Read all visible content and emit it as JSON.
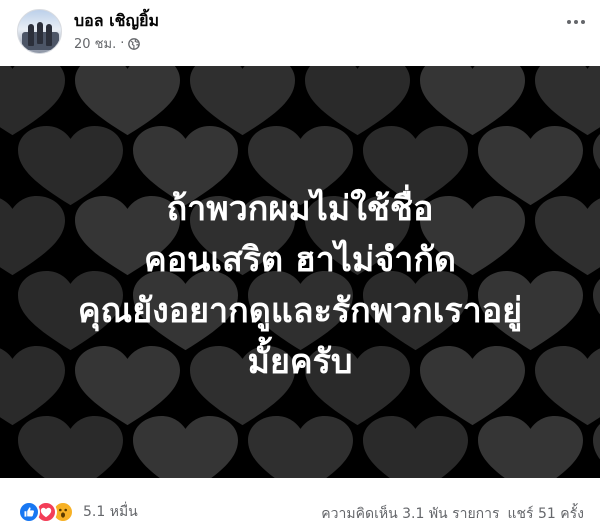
{
  "post": {
    "author": "บอล เชิญยิ้ม",
    "time": "20 ชม.",
    "separator": "·",
    "privacy_icon": "globe-icon",
    "more_icon": "more-options-icon"
  },
  "image": {
    "background": "black-heart-pattern",
    "caption_lines": [
      "ถ้าพวกผมไม่ใช้ชื่อ",
      "คอนเสริต ฮาไม่จำกัด",
      "คุณยังอยากดูและรักพวกเราอยู่",
      "มั้ยครับ"
    ]
  },
  "footer": {
    "reaction_icons": [
      "like-icon",
      "love-icon",
      "wow-icon"
    ],
    "reaction_count": "5.1 หมื่น",
    "comments": "ความคิดเห็น 3.1 พัน รายการ",
    "shares": "แชร์ 51 ครั้ง"
  },
  "colors": {
    "like": "#1877f2",
    "love": "#f33e58",
    "wow": "#f7b125",
    "secondary_text": "#65676b"
  }
}
